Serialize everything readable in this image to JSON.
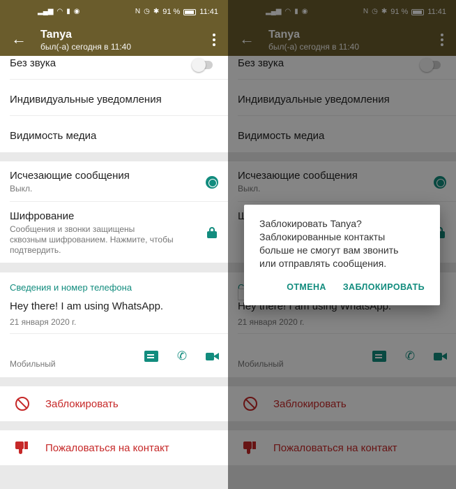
{
  "status_bar": {
    "left_icons": [
      "signal-icon",
      "wifi-icon",
      "sim-icon",
      "data-icon"
    ],
    "battery_percent": "91 %",
    "time": "11:41"
  },
  "header": {
    "contact_name": "Tanya",
    "last_seen": "был(-а) сегодня в 11:40"
  },
  "settings": {
    "mute_label": "Без звука",
    "custom_notifications_label": "Индивидуальные уведомления",
    "media_visibility_label": "Видимость медиа",
    "disappearing_label": "Исчезающие сообщения",
    "disappearing_value": "Выкл.",
    "encryption_label": "Шифрование",
    "encryption_desc_1": "Сообщения и звонки защищены",
    "encryption_desc_2": "сквозным шифрованием. Нажмите, чтобы",
    "encryption_desc_3": "подтвердить."
  },
  "about": {
    "section_title": "Сведения и номер телефона",
    "status_text": "Hey there! I am using WhatsApp.",
    "status_date": "21 января 2020 г.",
    "phone_type": "Мобильный"
  },
  "actions": {
    "block_label": "Заблокировать",
    "report_label": "Пожаловаться на контакт"
  },
  "dialog": {
    "line1": "Заблокировать Tanya?",
    "line2": "Заблокированные контакты",
    "line3": "больше не смогут вам звонить",
    "line4": "или отправлять сообщения.",
    "cancel_label": "ОТМЕНА",
    "confirm_label": "ЗАБЛОКИРОВАТЬ"
  },
  "colors": {
    "app_bar": "#6a5c2c",
    "accent": "#128c7e",
    "danger": "#c62828"
  }
}
